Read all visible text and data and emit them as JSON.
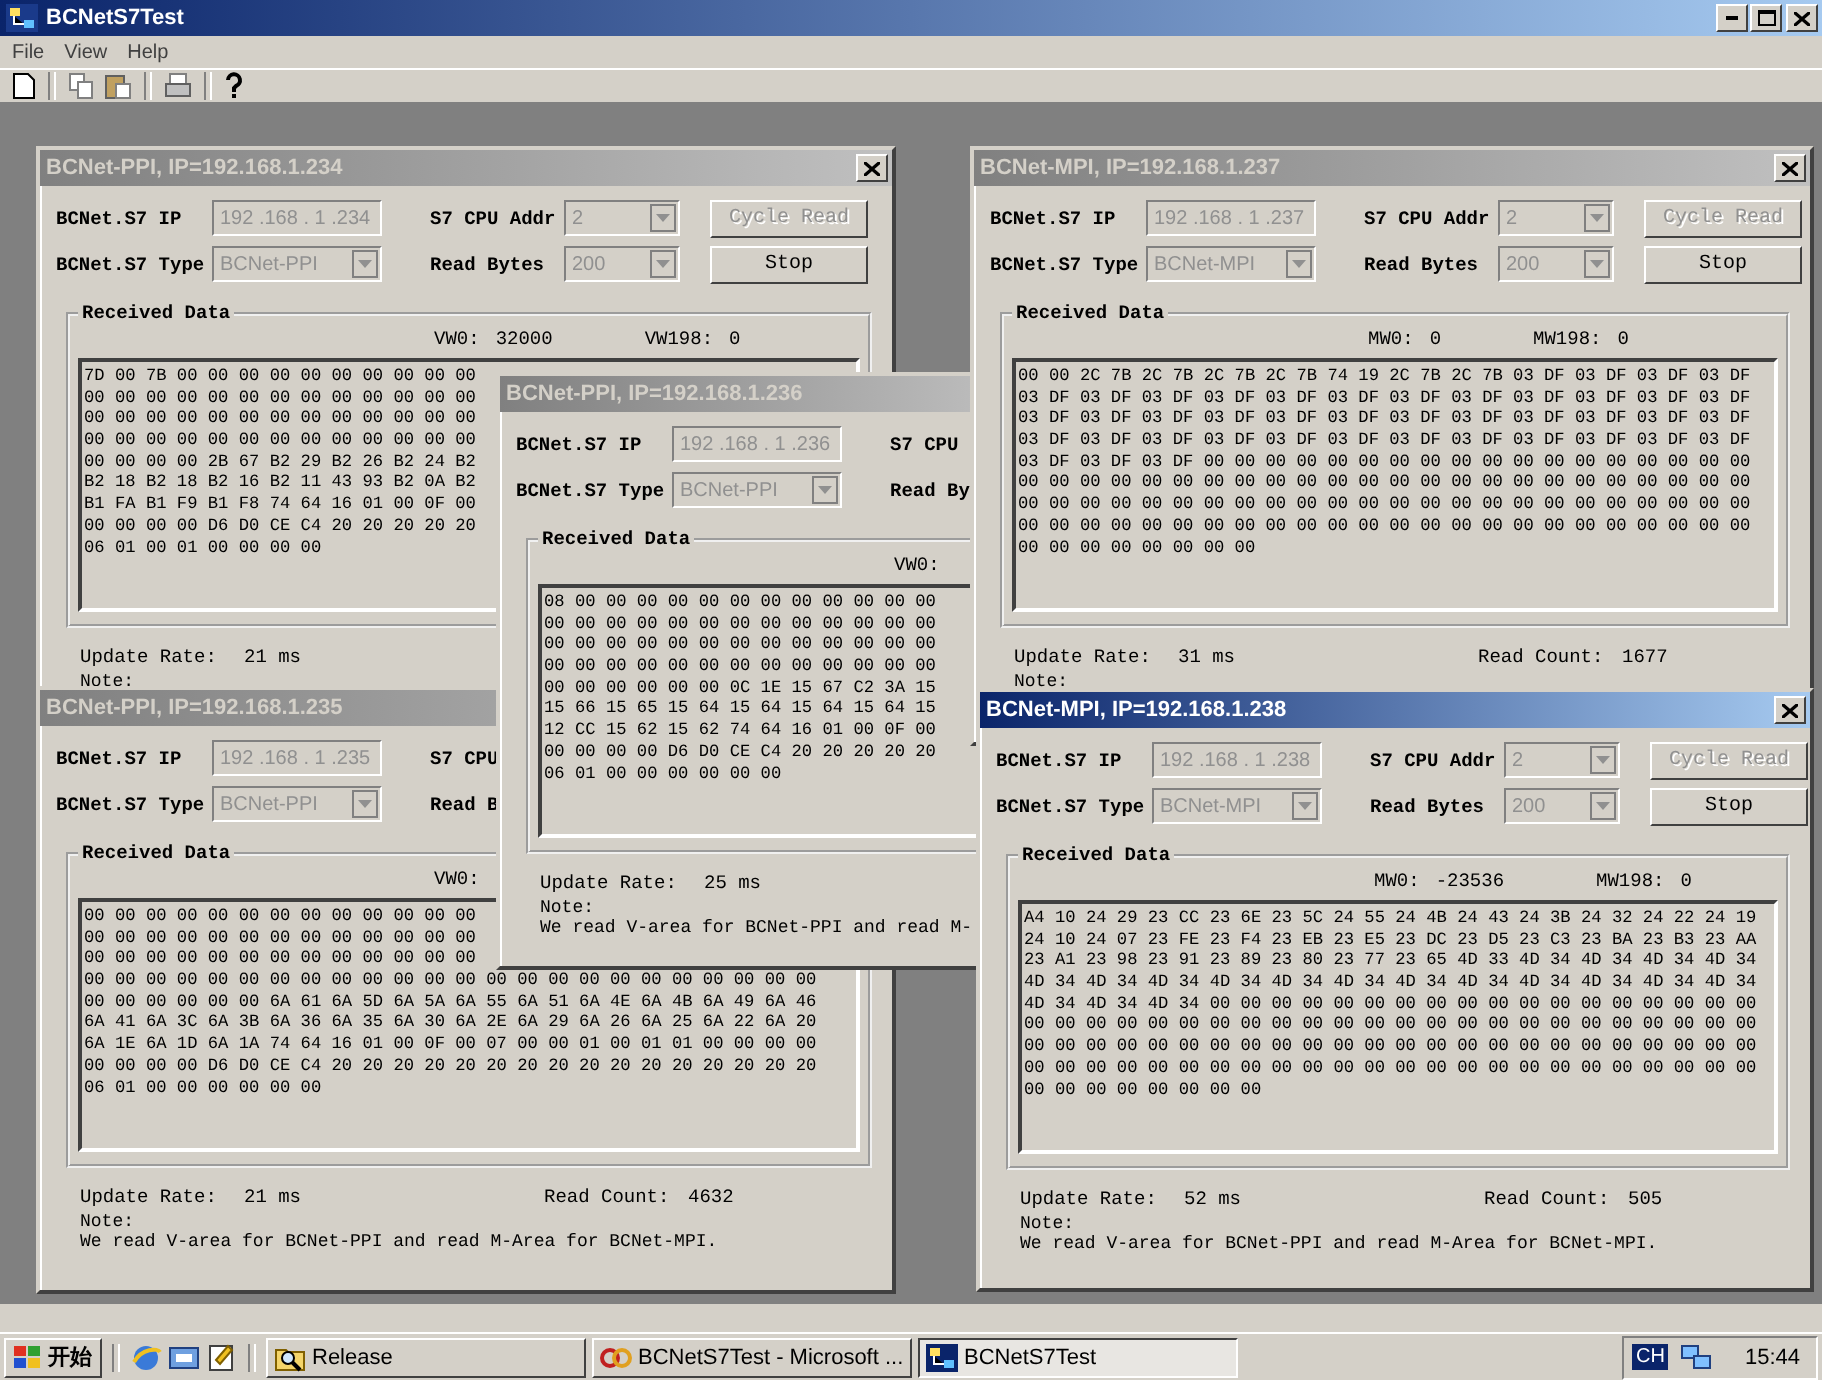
{
  "app": {
    "title": "BCNetS7Test"
  },
  "menu": [
    {
      "label": "File"
    },
    {
      "label": "View"
    },
    {
      "label": "Help"
    }
  ],
  "windows": [
    {
      "title": "BCNet-PPI, IP=192.168.1.234",
      "active": false,
      "close_button": true,
      "controls_disabled": true,
      "ip_label": "BCNet.S7 IP",
      "ip": "192 .168 . 1 .234",
      "type_label": "BCNet.S7 Type",
      "type": "BCNet-PPI",
      "cpu_label": "S7 CPU Addr",
      "cpu": "2",
      "bytes_label": "Read Bytes",
      "bytes": "200",
      "buttons": [
        {
          "label": "Cycle Read",
          "disabled": true
        },
        {
          "label": "Stop",
          "disabled": false
        }
      ],
      "group_label": "Received Data",
      "readings": [
        {
          "label": "VW0:",
          "value": "32000"
        },
        {
          "label": "VW198:",
          "value": "0"
        }
      ],
      "hex_rows": [
        "7D 00 7B 00 00 00 00 00 00 00 00 00 00",
        "00 00 00 00 00 00 00 00 00 00 00 00 00",
        "00 00 00 00 00 00 00 00 00 00 00 00 00",
        "00 00 00 00 00 00 00 00 00 00 00 00 00",
        "00 00 00 00 2B 67 B2 29 B2 26 B2 24 B2",
        "B2 18 B2 18 B2 16 B2 11 43 93 B2 0A B2",
        "B1 FA B1 F9 B1 F8 74 64 16 01 00 0F 00",
        "00 00 00 00 D6 D0 CE C4 20 20 20 20 20",
        "06 01 00 01 00 00 00 00"
      ],
      "update_label": "Update Rate:",
      "update_value": "21 ms",
      "note_label": "Note:"
    },
    {
      "title": "BCNet-PPI, IP=192.168.1.235",
      "active": false,
      "controls_disabled": true,
      "ip_label": "BCNet.S7 IP",
      "ip": "192 .168 . 1 .235",
      "type_label": "BCNet.S7 Type",
      "type": "BCNet-PPI",
      "cpu_label": "S7 CPU",
      "bytes_label": "Read B",
      "group_label": "Received Data",
      "readings": [
        {
          "label": "VW0:"
        }
      ],
      "hex_rows": [
        "00 00 00 00 00 00 00 00 00 00 00 00 00",
        "00 00 00 00 00 00 00 00 00 00 00 00 00",
        "00 00 00 00 00 00 00 00 00 00 00 00 00",
        "00 00 00 00 00 00 00 00 00 00 00 00 00 00 00 00 00 00 00 00 00 00 00 00",
        "00 00 00 00 00 00 6A 61 6A 5D 6A 5A 6A 55 6A 51 6A 4E 6A 4B 6A 49 6A 46",
        "6A 41 6A 3C 6A 3B 6A 36 6A 35 6A 30 6A 2E 6A 29 6A 26 6A 25 6A 22 6A 20",
        "6A 1E 6A 1D 6A 1A 74 64 16 01 00 0F 00 07 00 00 01 00 01 01 00 00 00 00",
        "00 00 00 00 D6 D0 CE C4 20 20 20 20 20 20 20 20 20 20 20 20 20 20 20 20",
        "06 01 00 00 00 00 00 00"
      ],
      "update_label": "Update Rate:",
      "update_value": "21 ms",
      "count_label": "Read Count:",
      "count_value": "4632",
      "note_label": "Note:",
      "note": "We read V-area for BCNet-PPI and read M-Area for BCNet-MPI."
    },
    {
      "title": "BCNet-PPI, IP=192.168.1.236",
      "active": false,
      "controls_disabled": true,
      "ip_label": "BCNet.S7 IP",
      "ip": "192 .168 . 1 .236",
      "type_label": "BCNet.S7 Type",
      "type": "BCNet-PPI",
      "cpu_label": "S7 CPU",
      "bytes_label": "Read By",
      "group_label": "Received Data",
      "readings": [
        {
          "label": "VW0:"
        }
      ],
      "hex_rows": [
        "08 00 00 00 00 00 00 00 00 00 00 00 00",
        "00 00 00 00 00 00 00 00 00 00 00 00 00",
        "00 00 00 00 00 00 00 00 00 00 00 00 00",
        "00 00 00 00 00 00 00 00 00 00 00 00 00",
        "00 00 00 00 00 00 0C 1E 15 67 C2 3A 15",
        "15 66 15 65 15 64 15 64 15 64 15 64 15",
        "12 CC 15 62 15 62 74 64 16 01 00 0F 00",
        "00 00 00 00 D6 D0 CE C4 20 20 20 20 20",
        "06 01 00 00 00 00 00 00"
      ],
      "update_label": "Update Rate:",
      "update_value": "25 ms",
      "note_label": "Note:",
      "note": "We read V-area for BCNet-PPI and read M-"
    },
    {
      "title": "BCNet-MPI, IP=192.168.1.237",
      "active": false,
      "close_button": true,
      "controls_disabled": true,
      "ip_label": "BCNet.S7 IP",
      "ip": "192 .168 . 1 .237",
      "type_label": "BCNet.S7 Type",
      "type": "BCNet-MPI",
      "cpu_label": "S7 CPU Addr",
      "cpu": "2",
      "bytes_label": "Read Bytes",
      "bytes": "200",
      "buttons": [
        {
          "label": "Cycle Read",
          "disabled": true
        },
        {
          "label": "Stop",
          "disabled": false
        }
      ],
      "group_label": "Received Data",
      "readings": [
        {
          "label": "MW0:",
          "value": "0"
        },
        {
          "label": "MW198:",
          "value": "0"
        }
      ],
      "hex_rows": [
        "00 00 2C 7B 2C 7B 2C 7B 2C 7B 74 19 2C 7B 2C 7B 03 DF 03 DF 03 DF 03 DF",
        "03 DF 03 DF 03 DF 03 DF 03 DF 03 DF 03 DF 03 DF 03 DF 03 DF 03 DF 03 DF",
        "03 DF 03 DF 03 DF 03 DF 03 DF 03 DF 03 DF 03 DF 03 DF 03 DF 03 DF 03 DF",
        "03 DF 03 DF 03 DF 03 DF 03 DF 03 DF 03 DF 03 DF 03 DF 03 DF 03 DF 03 DF",
        "03 DF 03 DF 03 DF 00 00 00 00 00 00 00 00 00 00 00 00 00 00 00 00 00 00",
        "00 00 00 00 00 00 00 00 00 00 00 00 00 00 00 00 00 00 00 00 00 00 00 00",
        "00 00 00 00 00 00 00 00 00 00 00 00 00 00 00 00 00 00 00 00 00 00 00 00",
        "00 00 00 00 00 00 00 00 00 00 00 00 00 00 00 00 00 00 00 00 00 00 00 00",
        "00 00 00 00 00 00 00 00"
      ],
      "update_label": "Update Rate:",
      "update_value": "31 ms",
      "count_label": "Read Count:",
      "count_value": "1677",
      "note_label": "Note:"
    },
    {
      "title": "BCNet-MPI, IP=192.168.1.238",
      "active": true,
      "close_button": true,
      "controls_disabled": true,
      "ip_label": "BCNet.S7 IP",
      "ip": "192 .168 . 1 .238",
      "type_label": "BCNet.S7 Type",
      "type": "BCNet-MPI",
      "cpu_label": "S7 CPU Addr",
      "cpu": "2",
      "bytes_label": "Read Bytes",
      "bytes": "200",
      "buttons": [
        {
          "label": "Cycle Read",
          "disabled": true
        },
        {
          "label": "Stop",
          "disabled": false
        }
      ],
      "group_label": "Received Data",
      "readings": [
        {
          "label": "MW0:",
          "value": "-23536"
        },
        {
          "label": "MW198:",
          "value": "0"
        }
      ],
      "hex_rows": [
        "A4 10 24 29 23 CC 23 6E 23 5C 24 55 24 4B 24 43 24 3B 24 32 24 22 24 19",
        "24 10 24 07 23 FE 23 F4 23 EB 23 E5 23 DC 23 D5 23 C3 23 BA 23 B3 23 AA",
        "23 A1 23 98 23 91 23 89 23 80 23 77 23 65 4D 33 4D 34 4D 34 4D 34 4D 34",
        "4D 34 4D 34 4D 34 4D 34 4D 34 4D 34 4D 34 4D 34 4D 34 4D 34 4D 34 4D 34",
        "4D 34 4D 34 4D 34 00 00 00 00 00 00 00 00 00 00 00 00 00 00 00 00 00 00",
        "00 00 00 00 00 00 00 00 00 00 00 00 00 00 00 00 00 00 00 00 00 00 00 00",
        "00 00 00 00 00 00 00 00 00 00 00 00 00 00 00 00 00 00 00 00 00 00 00 00",
        "00 00 00 00 00 00 00 00 00 00 00 00 00 00 00 00 00 00 00 00 00 00 00 00",
        "00 00 00 00 00 00 00 00"
      ],
      "update_label": "Update Rate:",
      "update_value": "52 ms",
      "count_label": "Read Count:",
      "count_value": "505",
      "note_label": "Note:",
      "note": "We read V-area for BCNet-PPI and read M-Area for BCNet-MPI."
    }
  ],
  "taskbar": {
    "start": "开始",
    "tasks": [
      {
        "label": "Release",
        "kind": "folder",
        "selected": false
      },
      {
        "label": "BCNetS7Test - Microsoft ...",
        "kind": "studio",
        "selected": false
      },
      {
        "label": "BCNetS7Test",
        "kind": "app",
        "selected": true
      }
    ],
    "language": "CH",
    "clock": "15:44"
  }
}
